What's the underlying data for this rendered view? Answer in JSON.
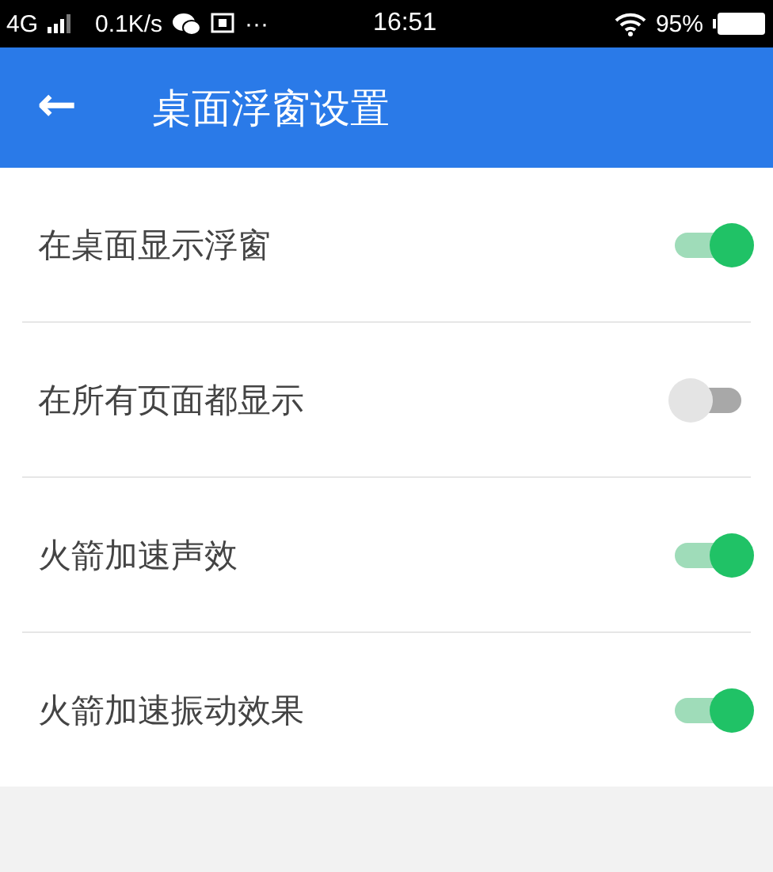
{
  "status_bar": {
    "network": "4G",
    "speed": "0.1K/s",
    "more": "···",
    "time": "16:51",
    "battery": "95%"
  },
  "header": {
    "back": "←",
    "title": "桌面浮窗设置"
  },
  "settings": [
    {
      "label": "在桌面显示浮窗",
      "on": true
    },
    {
      "label": "在所有页面都显示",
      "on": false
    },
    {
      "label": "火箭加速声效",
      "on": true
    },
    {
      "label": "火箭加速振动效果",
      "on": true
    }
  ]
}
